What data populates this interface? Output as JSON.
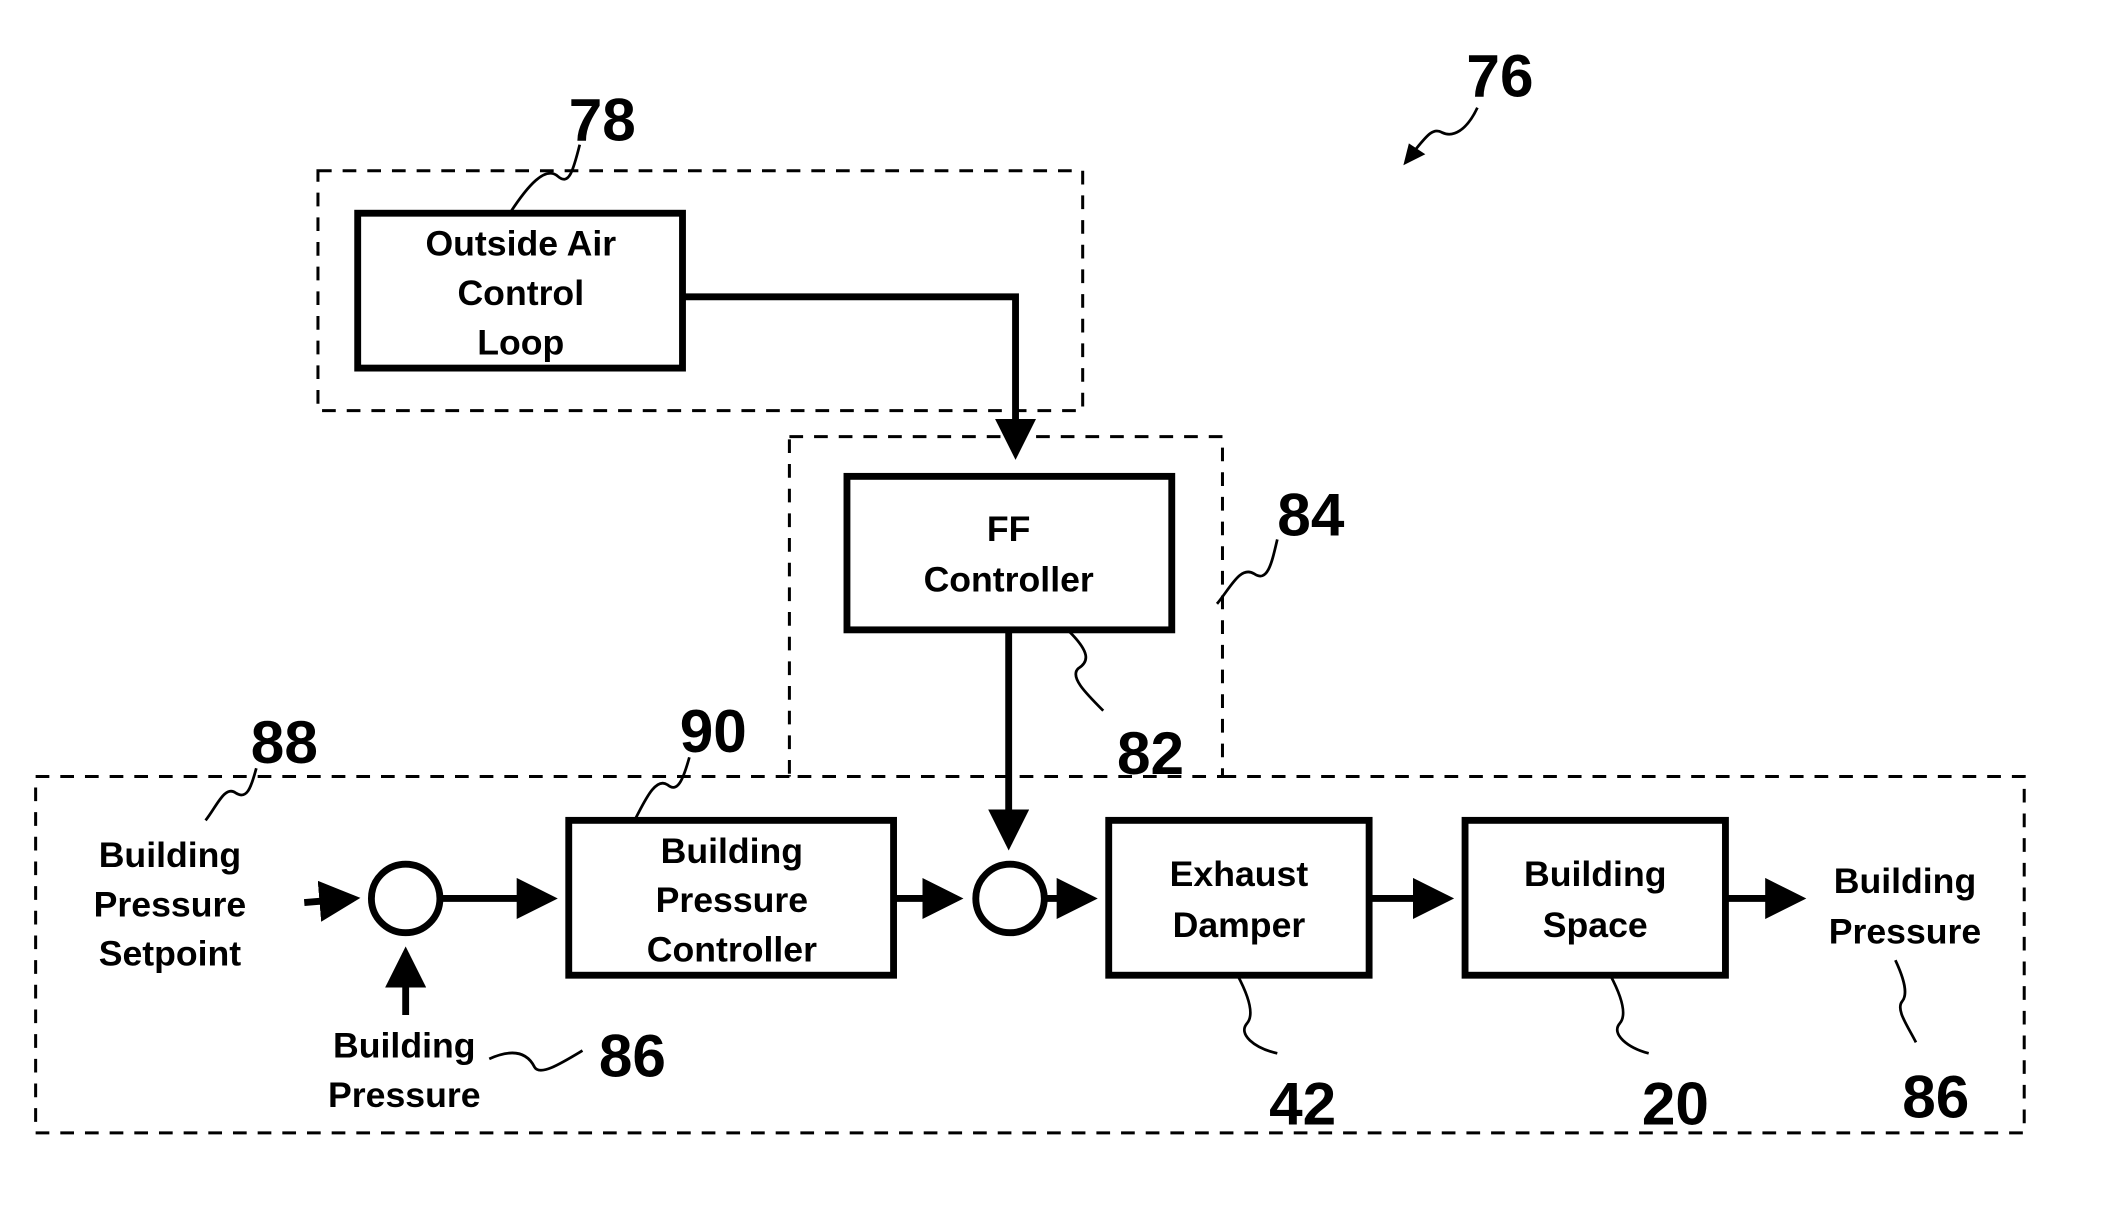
{
  "figure": {
    "reference": "76",
    "groups": [
      {
        "id": "outside-air-group",
        "reference": "78"
      },
      {
        "id": "ff-group",
        "reference": "84"
      },
      {
        "id": "building-pressure-group",
        "reference": ""
      }
    ],
    "blocks": {
      "outside_air": {
        "lines": [
          "Outside Air",
          "Control",
          "Loop"
        ],
        "reference": "78"
      },
      "ff_controller": {
        "lines": [
          "FF",
          "Controller"
        ],
        "reference": "82"
      },
      "bp_controller": {
        "lines": [
          "Building",
          "Pressure",
          "Controller"
        ],
        "reference": "90"
      },
      "exhaust_damper": {
        "lines": [
          "Exhaust",
          "Damper"
        ],
        "reference": "42"
      },
      "building_space": {
        "lines": [
          "Building",
          "Space"
        ],
        "reference": "20"
      }
    },
    "signals": {
      "setpoint": {
        "lines": [
          "Building",
          "Pressure",
          "Setpoint"
        ],
        "reference": "88"
      },
      "feedback": {
        "lines": [
          "Building",
          "Pressure"
        ],
        "reference": "86"
      },
      "output": {
        "lines": [
          "Building",
          "Pressure"
        ],
        "reference": "86"
      }
    }
  }
}
